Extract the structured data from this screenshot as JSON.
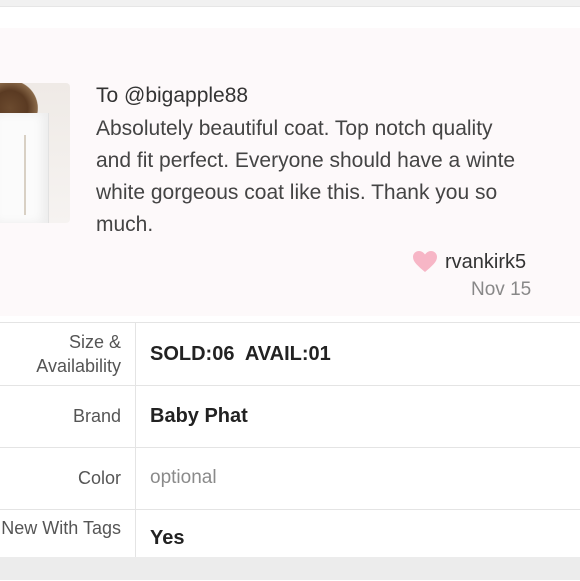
{
  "review": {
    "to": "To @bigapple88",
    "body_lines": [
      "Absolutely beautiful coat. Top notch quality",
      "and fit perfect. Everyone should have a winte",
      "white gorgeous coat like this. Thank you so",
      "much."
    ],
    "reviewer": "rvankirk5",
    "date": "Nov 15",
    "heart_color": "#f7b6c6"
  },
  "details": [
    {
      "label": "Size & Availability",
      "value": "SOLD:06  AVAIL:01"
    },
    {
      "label": "Brand",
      "value": "Baby Phat"
    },
    {
      "label": "Color",
      "value": "optional"
    },
    {
      "label": "New With Tags",
      "value": "Yes"
    }
  ],
  "colors": {
    "review_bg": "#fdf9fa",
    "divider": "#e4e4e4",
    "placeholder_text": "#8a8a8a"
  }
}
